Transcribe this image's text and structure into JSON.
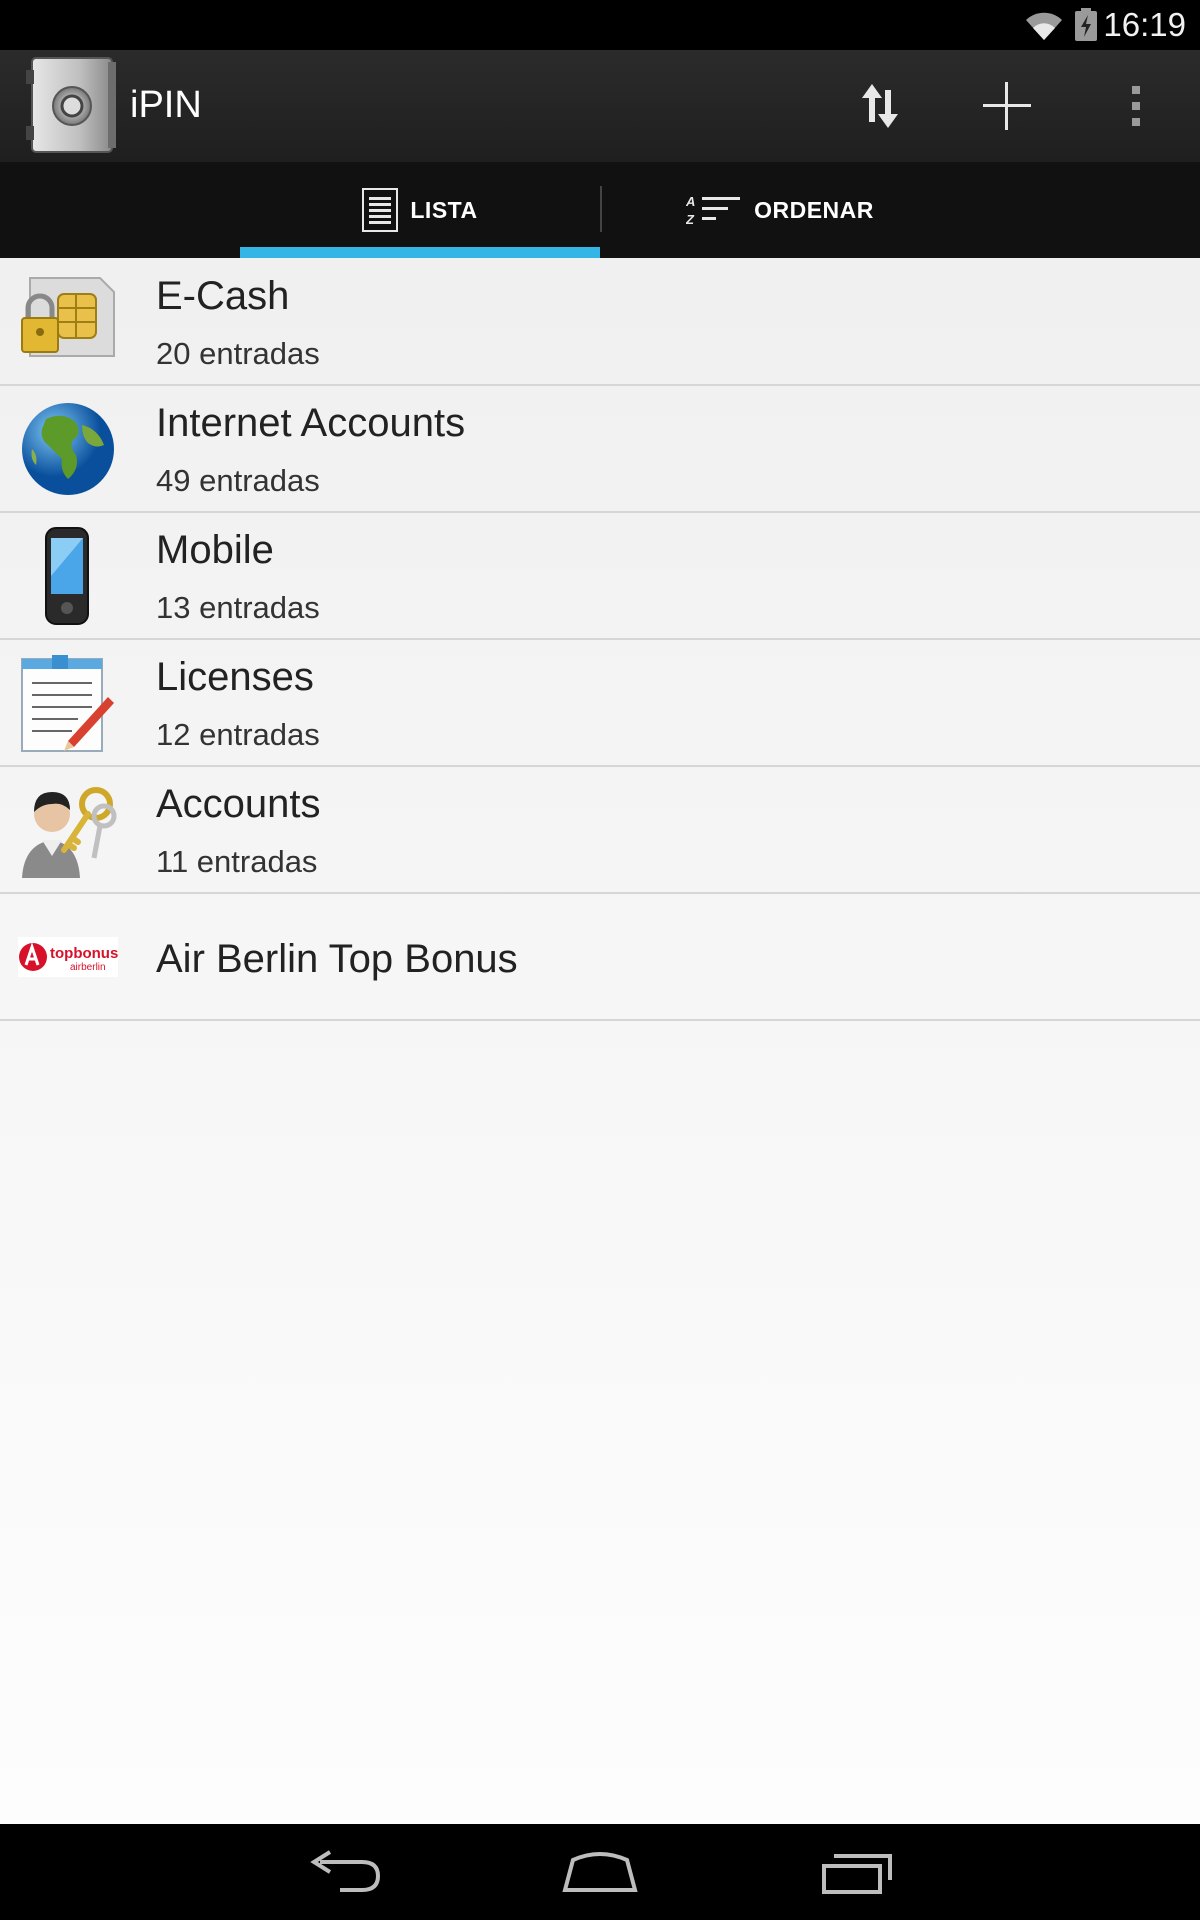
{
  "status_bar": {
    "time": "16:19",
    "icons": [
      "wifi-icon",
      "battery-charging-icon"
    ]
  },
  "action_bar": {
    "app_title": "iPIN",
    "app_icon": "safe-icon",
    "actions": [
      "sort-updown-icon",
      "add-icon",
      "overflow-menu-icon"
    ]
  },
  "tabs": [
    {
      "label": "LISTA",
      "icon": "list-icon",
      "selected": true
    },
    {
      "label": "ORDENAR",
      "icon": "sort-az-icon",
      "selected": false
    }
  ],
  "colors": {
    "accent": "#33b5e5",
    "actionbar": "#252525",
    "tabbar": "#111111"
  },
  "categories": [
    {
      "title": "E-Cash",
      "subtitle": "20 entradas",
      "icon": "sim-card-lock-icon"
    },
    {
      "title": "Internet Accounts",
      "subtitle": "49 entradas",
      "icon": "globe-icon"
    },
    {
      "title": "Mobile",
      "subtitle": "13 entradas",
      "icon": "mobile-phone-icon"
    },
    {
      "title": "Licenses",
      "subtitle": "12 entradas",
      "icon": "document-pencil-icon"
    },
    {
      "title": "Accounts",
      "subtitle": "11 entradas",
      "icon": "user-key-icon"
    },
    {
      "title": "Air Berlin Top Bonus",
      "subtitle": "",
      "icon": "topbonus-logo-icon",
      "logo_text": [
        "topbonus",
        "airberlin"
      ]
    }
  ],
  "nav_bar": [
    "back-icon",
    "home-icon",
    "recent-apps-icon"
  ]
}
